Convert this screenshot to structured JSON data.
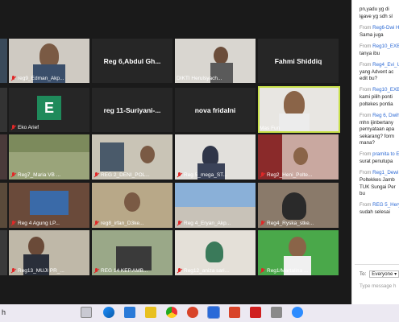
{
  "tiles": {
    "r1c2": {
      "caption": "reg9_Edman_Akp..."
    },
    "r1c3": {
      "name": "Reg 6,Abdul Gh..."
    },
    "r1c4": {
      "caption": "DIKTI Herulsyach..."
    },
    "r1c5": {
      "name": "Fahmi Shiddiq"
    },
    "r2c2": {
      "avatar_letter": "E",
      "caption": "Eko Arief"
    },
    "r2c3": {
      "name": "reg  11-Suriyani-..."
    },
    "r2c4": {
      "name": "nova fridalni"
    },
    "r2c5": {
      "caption": "Mas Fun"
    },
    "r3c2": {
      "caption": "Reg7_Maria VB ..."
    },
    "r3c3": {
      "caption": "REG 2_DENI_POL..."
    },
    "r3c4": {
      "caption": "Reg 5_mega_ST..."
    },
    "r3c5": {
      "caption": "Reg2_Heni_Polte..."
    },
    "r4c2": {
      "caption": "Reg 4 Agung LP..."
    },
    "r4c3": {
      "caption": "reg8_irfan_D3ke..."
    },
    "r4c4": {
      "caption": "Reg 4_Eryan_Akp..."
    },
    "r4c5": {
      "caption": "Reg4_Ryska_stke..."
    },
    "r5c2": {
      "caption": "Reg13_MUJI PR_..."
    },
    "r5c3": {
      "caption": "REG 14 KEP.AMB..."
    },
    "r5c4": {
      "caption": "Reg12_aniza sari..."
    },
    "r5c5": {
      "caption": "Reg1/Martalina ..."
    }
  },
  "chat": {
    "close_glyph": "×",
    "messages": [
      {
        "lines": [
          "pn,yadu yg di",
          "leave yg sdh sl"
        ]
      },
      {
        "from": "Reg6-Dwi H",
        "lines": [
          "Sama juga"
        ]
      },
      {
        "from": "Reg10_EXBE",
        "lines": [
          "tanya ibu"
        ]
      },
      {
        "from": "Reg4_Evi_Ul",
        "lines": [
          "yang Advent ac",
          "edit bu?"
        ]
      },
      {
        "from": "Reg10_EXBE",
        "lines": [
          "kami pilih ponti",
          "poltekes pontia"
        ]
      },
      {
        "from": "Reg 6, Dwih",
        "lines": [
          "mhn ijinbertany",
          "pernyataan apa",
          "sekarang? form",
          "mana?"
        ]
      },
      {
        "from": "pramita to E",
        "lines": [
          "surat penutupa"
        ]
      },
      {
        "from": "Reg1_Dewi N",
        "lines": [
          "Poltekkes Jamb",
          "TUK Sungai Per",
          "bu"
        ]
      },
      {
        "from": "REG 5_Hery",
        "lines": [
          "sudah selesai"
        ]
      }
    ],
    "from_prefix": "From",
    "to_label": "To:",
    "to_value": "Everyone",
    "input_placeholder": "Type message h"
  },
  "taskbar": {
    "search_text": "h"
  }
}
